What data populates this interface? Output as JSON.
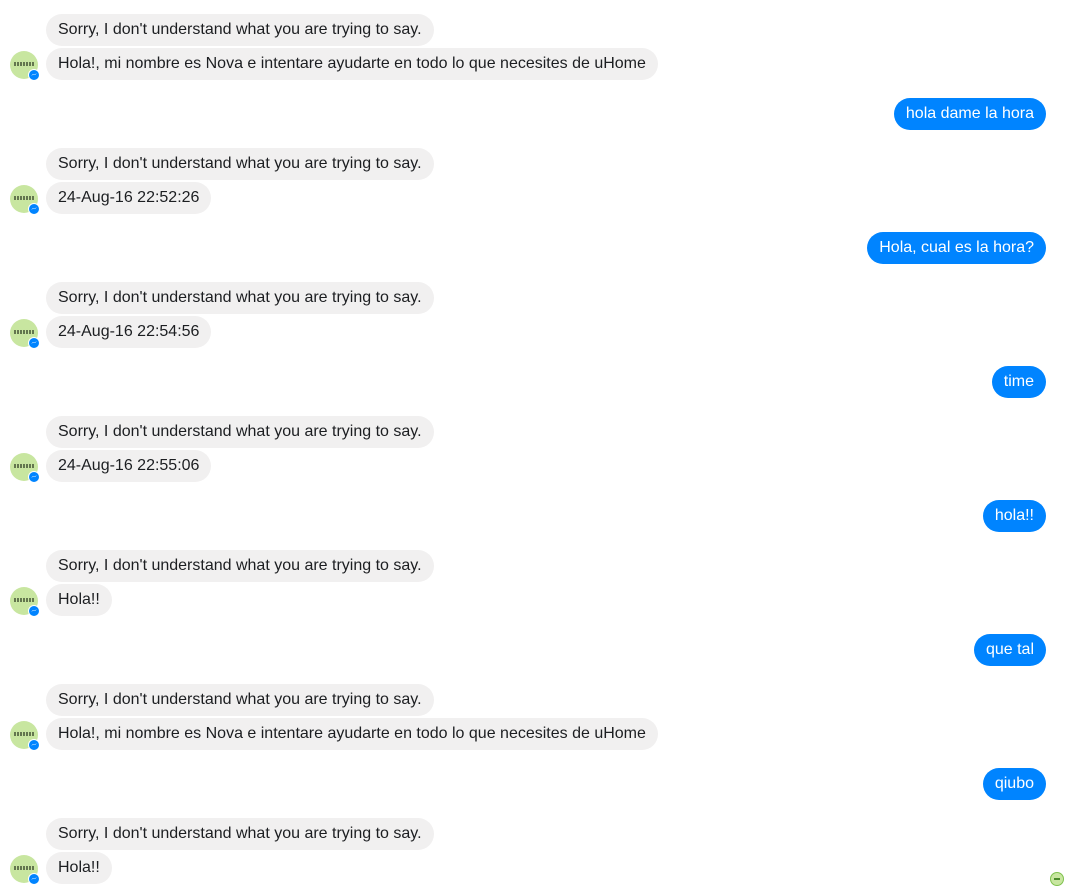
{
  "conversation": {
    "messages": [
      {
        "sender": "bot",
        "text": "Sorry, I don't understand what you are trying to say."
      },
      {
        "sender": "bot",
        "text": "Hola!, mi nombre es Nova e intentare ayudarte en todo lo que necesites de uHome"
      },
      {
        "sender": "user",
        "text": "hola dame la hora"
      },
      {
        "sender": "bot",
        "text": "Sorry, I don't understand what you are trying to say."
      },
      {
        "sender": "bot",
        "text": "24-Aug-16 22:52:26"
      },
      {
        "sender": "user",
        "text": "Hola, cual es la hora?"
      },
      {
        "sender": "bot",
        "text": "Sorry, I don't understand what you are trying to say."
      },
      {
        "sender": "bot",
        "text": "24-Aug-16 22:54:56"
      },
      {
        "sender": "user",
        "text": "time"
      },
      {
        "sender": "bot",
        "text": "Sorry, I don't understand what you are trying to say."
      },
      {
        "sender": "bot",
        "text": "24-Aug-16 22:55:06"
      },
      {
        "sender": "user",
        "text": "hola!!"
      },
      {
        "sender": "bot",
        "text": "Sorry, I don't understand what you are trying to say."
      },
      {
        "sender": "bot",
        "text": "Hola!!"
      },
      {
        "sender": "user",
        "text": "que tal"
      },
      {
        "sender": "bot",
        "text": "Sorry, I don't understand what you are trying to say."
      },
      {
        "sender": "bot",
        "text": "Hola!, mi nombre es Nova e intentare ayudarte en todo lo que necesites de uHome"
      },
      {
        "sender": "user",
        "text": "qiubo"
      },
      {
        "sender": "bot",
        "text": "Sorry, I don't understand what you are trying to say."
      },
      {
        "sender": "bot",
        "text": "Hola!!"
      }
    ]
  },
  "icons": {
    "bot_avatar": "uhome-logo-avatar",
    "messenger_badge": "messenger-icon",
    "seen_indicator": "seen-avatar-icon"
  },
  "colors": {
    "user_bubble": "#0084ff",
    "bot_bubble": "#f1f0f0",
    "avatar_bg": "#c8e6a0"
  }
}
